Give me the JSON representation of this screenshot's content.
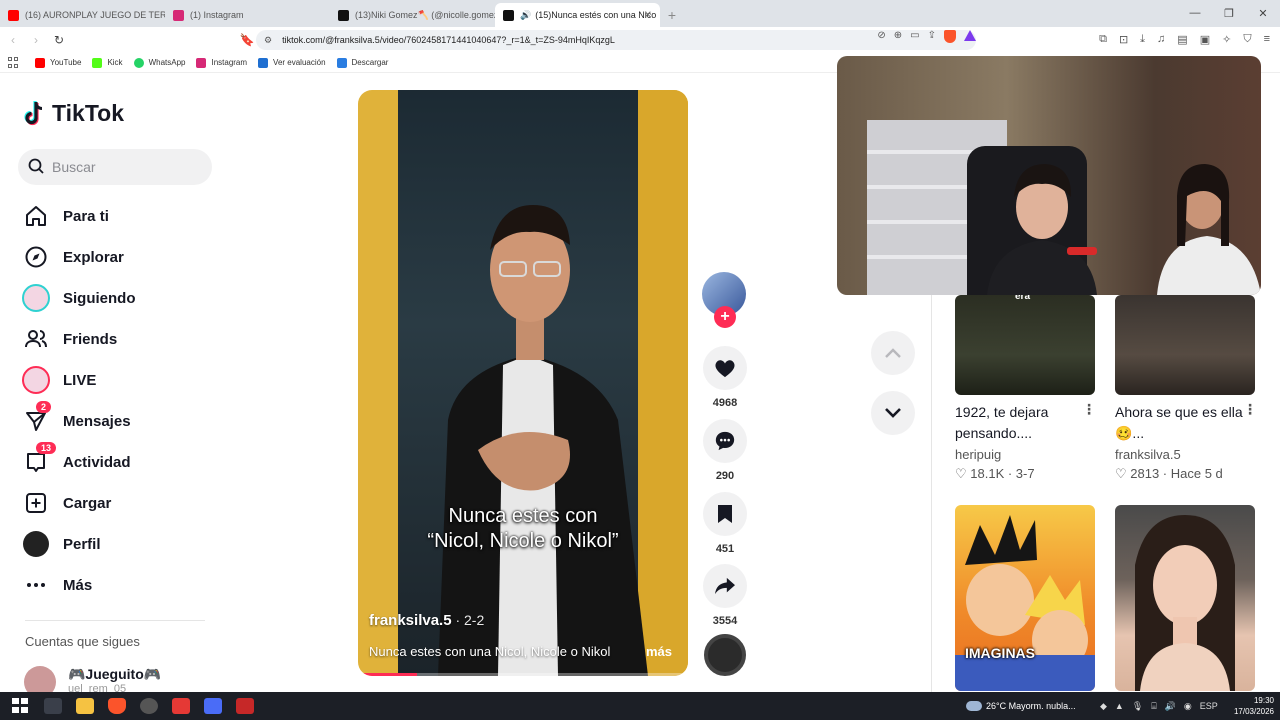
{
  "browser": {
    "tabs": [
      {
        "label": "(16) AURONPLAY JUEGO DE TERROR",
        "color": "#ff0000"
      },
      {
        "label": "(1) Instagram",
        "color": "#d62976"
      },
      {
        "label": "(13)Niki Gomez🪓 (@nicolle.gomez",
        "color": "#111111"
      },
      {
        "label": "(15)Nunca estés con una Nico",
        "color": "#111111"
      }
    ],
    "new_tab": "+",
    "url": "tiktok.com/@franksilva.5/video/7602458171441040647?_r=1&_t=ZS-94mHqIKqzgL",
    "window_controls": [
      "—",
      "❐",
      "✕"
    ]
  },
  "bookmarks": [
    {
      "label": "YouTube",
      "color": "#ff0000"
    },
    {
      "label": "Kick",
      "color": "#53fc18"
    },
    {
      "label": "WhatsApp",
      "color": "#25d366"
    },
    {
      "label": "Instagram",
      "color": "#d62976"
    },
    {
      "label": "Ver evaluación",
      "color": "#1f6fd1"
    },
    {
      "label": "Descargar",
      "color": "#2a7de1"
    }
  ],
  "sidebar": {
    "logo_text": "TikTok",
    "search_placeholder": "Buscar",
    "items": [
      {
        "label": "Para ti",
        "icon": "home-icon"
      },
      {
        "label": "Explorar",
        "icon": "compass-icon"
      },
      {
        "label": "Siguiendo",
        "icon": "avatar"
      },
      {
        "label": "Friends",
        "icon": "friends-icon"
      },
      {
        "label": "LIVE",
        "icon": "avatar"
      },
      {
        "label": "Mensajes",
        "icon": "send-icon",
        "badge": "2"
      },
      {
        "label": "Actividad",
        "icon": "inbox-icon",
        "badge": "13"
      },
      {
        "label": "Cargar",
        "icon": "upload-icon"
      },
      {
        "label": "Perfil",
        "icon": "avatar"
      },
      {
        "label": "Más",
        "icon": "more-icon"
      }
    ],
    "following_title": "Cuentas que sigues",
    "following": [
      {
        "name": "🎮Jueguito🎮",
        "handle": "uel_rem_05"
      }
    ]
  },
  "video": {
    "caption_overlay_line1": "Nunca estes con",
    "caption_overlay_line2": "“Nicol, Nicole o Nikol”",
    "username": "franksilva.5",
    "date": " · 2-2",
    "description": "Nunca estes con una Nicol, Nicole o Nikol",
    "more": "más",
    "progress": 0.18
  },
  "actions": {
    "follow_plus": "+",
    "likes": "4968",
    "comments": "290",
    "saves": "451",
    "shares": "3554"
  },
  "recommendations": [
    {
      "title": "1922, te dejara pensando....",
      "user": "heripuig",
      "meta": "♡ 18.1K · 3-7",
      "overlay": "era"
    },
    {
      "title": "Ahora se que es ella 🥴...",
      "user": "franksilva.5",
      "meta": "♡ 2813 · Hace 5 d"
    },
    {
      "title_overlay": "IMAGINAS"
    },
    {}
  ],
  "taskbar": {
    "weather": "26°C  Mayorm. nubla...",
    "lang": "ESP",
    "time": "19:30",
    "date": "17/03/2026"
  },
  "colors": {
    "accent": "#fe2c55",
    "teal": "#25f4ee",
    "text": "#161823"
  }
}
